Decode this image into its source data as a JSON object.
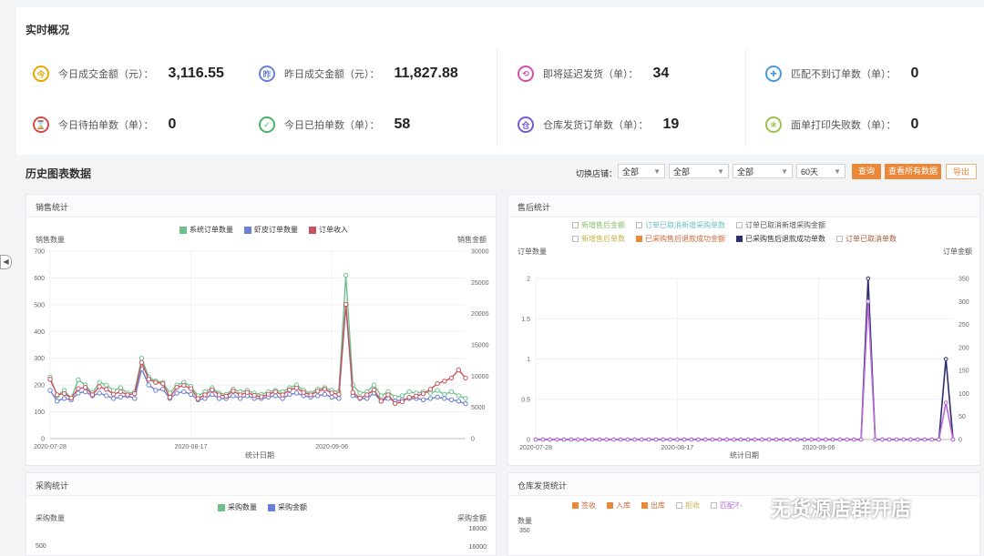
{
  "realtime": {
    "title": "实时概况",
    "stats": [
      {
        "icon": "今",
        "label": "今日成交金额（元）：",
        "value": "3,116.55",
        "color": "#e8a800"
      },
      {
        "icon": "昨",
        "label": "昨日成交金额（元）：",
        "value": "11,827.88",
        "color": "#6a7fd8"
      },
      {
        "icon": "⟲",
        "label": "即将延迟发货（单）：",
        "value": "34",
        "color": "#d04fb6"
      },
      {
        "icon": "✚",
        "label": "匹配不到订单数（单）：",
        "value": "0",
        "color": "#4a9ad8"
      },
      {
        "icon": "⌛",
        "label": "今日待拍单数（单）：",
        "value": "0",
        "color": "#d84a4a"
      },
      {
        "icon": "✓",
        "label": "今日已拍单数（单）：",
        "value": "58",
        "color": "#4ab26a"
      },
      {
        "icon": "仓",
        "label": "仓库发货订单数（单）：",
        "value": "19",
        "color": "#7a5ad0"
      },
      {
        "icon": "❀",
        "label": "面单打印失败数（单）：",
        "value": "0",
        "color": "#9ac24a"
      }
    ]
  },
  "history": {
    "title": "历史图表数据",
    "shop_switch_label": "切换店铺：",
    "filters": [
      "全部",
      "全部",
      "全部",
      "60天"
    ],
    "query_button": "查询",
    "view_button": "查看所有数据",
    "export_button": "导出"
  },
  "colors": {
    "green": "#6cc18b",
    "blue": "#6b7fd4",
    "red": "#c8515c",
    "purple": "#b86ad8",
    "navy": "#2d2f6e",
    "orange": "#e98838"
  },
  "sales": {
    "card_title": "销售统计",
    "legend": [
      "系统订单数量",
      "虾皮订单数量",
      "订单收入"
    ],
    "left_axis_label": "销售数量",
    "right_axis_label": "销售金额",
    "x_axis_label": "统计日期",
    "left_ticks": [
      "700",
      "600",
      "500",
      "400",
      "300",
      "200",
      "100",
      "0"
    ],
    "right_ticks": [
      "30000",
      "25000",
      "20000",
      "15000",
      "10000",
      "5000",
      "0"
    ],
    "x_ticks": [
      "2020-07-28",
      "2020-08-17",
      "2020-09-06"
    ]
  },
  "aftersale": {
    "card_title": "售后统计",
    "legend_row1": [
      "新增售后金额",
      "订单已取消新增采购单数",
      "订单已取消新增采购金额"
    ],
    "legend_row2": [
      "新增售后单数",
      "已采购售后退款成功金额",
      "已采购售后退款成功单数",
      "订单已取消单数"
    ],
    "left_axis_label": "订单数量",
    "right_axis_label": "订单金额",
    "x_axis_label": "统计日期",
    "left_ticks": [
      "2",
      "1.5",
      "1",
      "0.5",
      "0"
    ],
    "right_ticks": [
      "350",
      "300",
      "250",
      "200",
      "150",
      "100",
      "50",
      "0"
    ],
    "x_ticks": [
      "2020-07-28",
      "2020-08-17",
      "2020-09-06"
    ]
  },
  "purchase": {
    "card_title": "采购统计",
    "legend": [
      "采购数量",
      "采购金额"
    ],
    "left_axis_label": "采购数量",
    "right_axis_label": "采购金额",
    "left_ticks": [
      "500"
    ],
    "right_ticks": [
      "18000",
      "16000"
    ]
  },
  "warehouse": {
    "card_title": "仓库发货统计",
    "legend": [
      "签收",
      "入库",
      "出库",
      "拒收",
      "匹配不"
    ],
    "left_axis_label": "数量",
    "left_ticks": [
      "350"
    ]
  },
  "watermark": {
    "text": "无货源店群开店"
  },
  "chart_data": [
    {
      "type": "line",
      "title": "销售统计",
      "xlabel": "统计日期",
      "ylabel": "销售数量",
      "ylim": [
        0,
        700
      ],
      "y2label": "销售金额",
      "y2lim": [
        0,
        30000
      ],
      "x_ticks": [
        "2020-07-28",
        "2020-08-17",
        "2020-09-06"
      ],
      "x_count": 60,
      "series": [
        {
          "name": "系统订单数量",
          "axis": "left",
          "values": [
            230,
            160,
            180,
            150,
            220,
            200,
            170,
            210,
            200,
            180,
            190,
            170,
            175,
            300,
            230,
            215,
            210,
            170,
            200,
            210,
            195,
            160,
            175,
            190,
            170,
            165,
            185,
            175,
            180,
            170,
            165,
            175,
            180,
            175,
            190,
            200,
            180,
            170,
            185,
            190,
            180,
            175,
            610,
            200,
            170,
            175,
            200,
            160,
            175,
            155,
            160,
            175,
            170,
            175,
            170,
            180,
            165,
            175,
            160,
            150
          ]
        },
        {
          "name": "虾皮订单数量",
          "axis": "left",
          "values": [
            180,
            140,
            150,
            145,
            170,
            175,
            160,
            170,
            160,
            150,
            155,
            160,
            150,
            260,
            200,
            180,
            185,
            150,
            170,
            175,
            165,
            145,
            150,
            165,
            150,
            150,
            160,
            150,
            160,
            150,
            150,
            155,
            160,
            150,
            165,
            170,
            160,
            155,
            160,
            165,
            155,
            150,
            500,
            160,
            150,
            150,
            170,
            140,
            150,
            140,
            145,
            150,
            150,
            145,
            150,
            155,
            150,
            145,
            140,
            130
          ]
        },
        {
          "name": "订单收入",
          "axis": "right",
          "values": [
            9500,
            7000,
            7200,
            6500,
            8000,
            8200,
            7000,
            8300,
            7900,
            7100,
            7500,
            7000,
            7200,
            12200,
            9500,
            9000,
            8800,
            6600,
            8200,
            8500,
            8000,
            6400,
            7000,
            7800,
            7000,
            6800,
            7600,
            7000,
            7400,
            6900,
            6700,
            7100,
            7500,
            7000,
            7800,
            8100,
            7400,
            7000,
            7600,
            7900,
            7300,
            7100,
            21500,
            7400,
            6500,
            7000,
            7800,
            6000,
            7000,
            5600,
            5900,
            6600,
            6800,
            7200,
            7900,
            8800,
            9200,
            9700,
            11000,
            9700
          ]
        }
      ]
    },
    {
      "type": "line",
      "title": "售后统计",
      "xlabel": "统计日期",
      "ylabel": "订单数量",
      "ylim": [
        0,
        2
      ],
      "y2label": "订单金额",
      "y2lim": [
        0,
        350
      ],
      "x_ticks": [
        "2020-07-28",
        "2020-08-17",
        "2020-09-06"
      ],
      "x_count": 60,
      "series": [
        {
          "name": "已采购售后退款成功单数",
          "axis": "left",
          "values": [
            0,
            0,
            0,
            0,
            0,
            0,
            0,
            0,
            0,
            0,
            0,
            0,
            0,
            0,
            0,
            0,
            0,
            0,
            0,
            0,
            0,
            0,
            0,
            0,
            0,
            0,
            0,
            0,
            0,
            0,
            0,
            0,
            0,
            0,
            0,
            0,
            0,
            0,
            0,
            0,
            0,
            0,
            0,
            0,
            0,
            0,
            0,
            2,
            0,
            0,
            0,
            0,
            0,
            0,
            0,
            0,
            0,
            0,
            1,
            0
          ]
        },
        {
          "name": "已采购售后退款成功金额",
          "axis": "right",
          "values": [
            0,
            0,
            0,
            0,
            0,
            0,
            0,
            0,
            0,
            0,
            0,
            0,
            0,
            0,
            0,
            0,
            0,
            0,
            0,
            0,
            0,
            0,
            0,
            0,
            0,
            0,
            0,
            0,
            0,
            0,
            0,
            0,
            0,
            0,
            0,
            0,
            0,
            0,
            0,
            0,
            0,
            0,
            0,
            0,
            0,
            0,
            0,
            300,
            0,
            0,
            0,
            0,
            0,
            0,
            0,
            0,
            0,
            0,
            80,
            0
          ]
        }
      ]
    }
  ]
}
